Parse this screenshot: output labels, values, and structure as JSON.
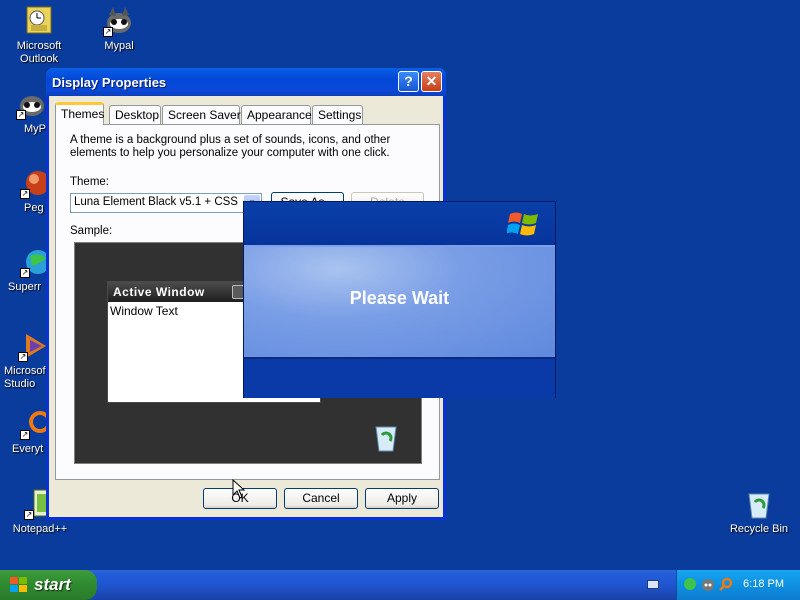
{
  "desktop": {
    "icons": [
      {
        "label": "Microsoft\nOutlook",
        "icon": "outlook-icon"
      },
      {
        "label": "Mypal",
        "icon": "mypal-icon"
      },
      {
        "label": "MyPa",
        "icon": "mypal-icon"
      },
      {
        "label": "Peg",
        "icon": "pegasus-icon"
      },
      {
        "label": "Superr",
        "icon": "globe-icon"
      },
      {
        "label": "Microsof\nStudio",
        "icon": "studio-icon"
      },
      {
        "label": "Everyt",
        "icon": "search-icon"
      },
      {
        "label": "Notepad++",
        "icon": "notepad-icon"
      },
      {
        "label": "Recycle Bin",
        "icon": "recycle-bin-icon"
      }
    ]
  },
  "window": {
    "title": "Display Properties",
    "help_glyph": "?",
    "close_glyph": "✕",
    "tabs": [
      "Themes",
      "Desktop",
      "Screen Saver",
      "Appearance",
      "Settings"
    ],
    "active_tab": "Themes",
    "description": "A theme is a background plus a set of sounds, icons, and other elements to help you personalize your computer with one click.",
    "theme_label": "Theme:",
    "theme_value": "Luna Element Black v5.1 + CSS",
    "save_as_label": "Save As...",
    "delete_label": "Delete",
    "sample_label": "Sample:",
    "sample_window_title": "Active Window",
    "sample_window_text": "Window Text",
    "ok_label": "OK",
    "cancel_label": "Cancel",
    "apply_label": "Apply"
  },
  "splash": {
    "message": "Please Wait"
  },
  "taskbar": {
    "start_label": "start",
    "clock": "6:18 PM"
  },
  "colors": {
    "desktop": "#0a3c9e",
    "titlebar": "#0347d6",
    "start_button": "#2f8a2f",
    "tray": "#0f8fe0"
  }
}
